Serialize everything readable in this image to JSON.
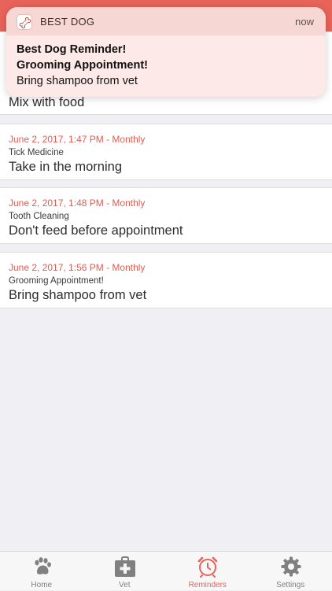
{
  "notification": {
    "app_name": "BEST DOG",
    "time": "now",
    "line1": "Best Dog Reminder!",
    "line2": "Grooming Appointment!",
    "line3": "Bring shampoo from vet",
    "icon": "bone-icon"
  },
  "reminders": [
    {
      "date": "",
      "title": "",
      "note": "Mix with food"
    },
    {
      "date": "June 2, 2017, 1:47 PM - Monthly",
      "title": "Tick Medicine",
      "note": "Take in the morning"
    },
    {
      "date": "June 2, 2017, 1:48 PM - Monthly",
      "title": "Tooth Cleaning",
      "note": "Don't feed before appointment"
    },
    {
      "date": "June 2, 2017, 1:56 PM - Monthly",
      "title": "Grooming Appointment!",
      "note": "Bring shampoo from vet"
    }
  ],
  "tabbar": {
    "active": "Reminders",
    "items": [
      {
        "label": "Home",
        "icon": "paw-icon"
      },
      {
        "label": "Vet",
        "icon": "first-aid-kit-icon"
      },
      {
        "label": "Reminders",
        "icon": "alarm-clock-icon"
      },
      {
        "label": "Settings",
        "icon": "gear-icon"
      }
    ]
  },
  "colors": {
    "accent": "#e8635a",
    "date_text": "#e25c52",
    "inactive_tab": "#808080",
    "background": "#efeff4"
  }
}
